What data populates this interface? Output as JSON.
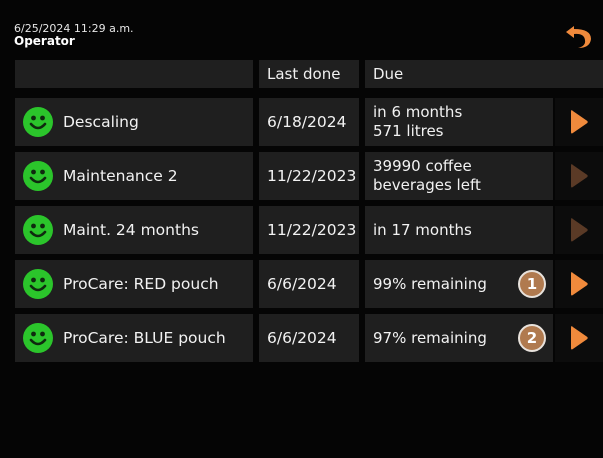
{
  "header": {
    "datetime": "6/25/2024 11:29 a.m.",
    "user": "Operator"
  },
  "table": {
    "columns": [
      "",
      "Last done",
      "Due"
    ],
    "rows": [
      {
        "name": "Descaling",
        "last_done": "6/18/2024",
        "due_line1": "in 6 months",
        "due_line2": "571 litres",
        "status": "ok",
        "arrow_enabled": true,
        "badge": ""
      },
      {
        "name": "Maintenance 2",
        "last_done": "11/22/2023",
        "due_line1": "39990 coffee",
        "due_line2": "beverages left",
        "status": "ok",
        "arrow_enabled": false,
        "badge": ""
      },
      {
        "name": "Maint. 24 months",
        "last_done": "11/22/2023",
        "due_line1": "in 17 months",
        "due_line2": "",
        "status": "ok",
        "arrow_enabled": false,
        "badge": ""
      },
      {
        "name": "ProCare: RED pouch",
        "last_done": "6/6/2024",
        "due_line1": "99% remaining",
        "due_line2": "",
        "status": "ok",
        "arrow_enabled": true,
        "badge": "1"
      },
      {
        "name": "ProCare: BLUE pouch",
        "last_done": "6/6/2024",
        "due_line1": "97% remaining",
        "due_line2": "",
        "status": "ok",
        "arrow_enabled": true,
        "badge": "2"
      }
    ]
  },
  "colors": {
    "accent_orange": "#f08a3c",
    "disabled_arrow": "#5a3a26",
    "status_green": "#2bc52b",
    "badge_brown": "#b07a4f",
    "cell_bg": "#1f1f1f"
  },
  "icons": {
    "back": "back-arrow-icon",
    "status": "smiley-icon",
    "row_action": "play-arrow-icon"
  }
}
